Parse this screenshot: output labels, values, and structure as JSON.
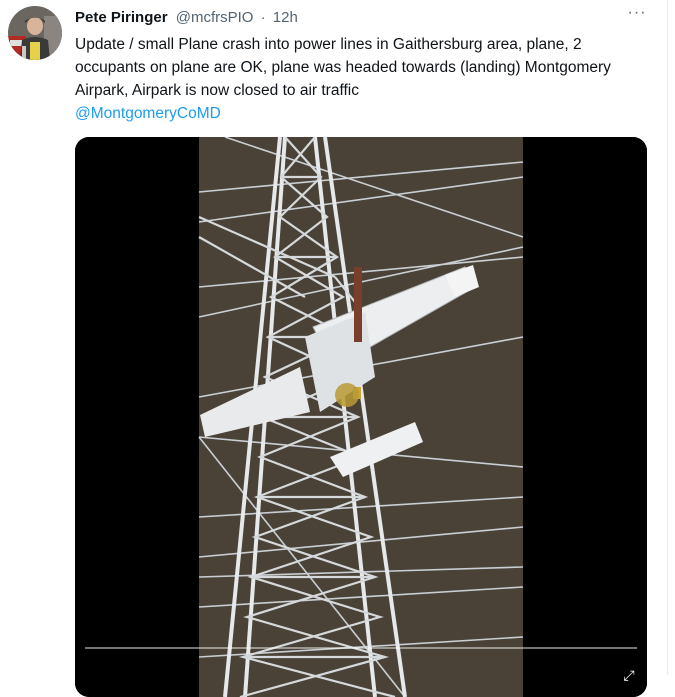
{
  "author": {
    "display_name": "Pete Piringer",
    "handle": "@mcfrsPIO",
    "separator": "·",
    "timestamp": "12h",
    "avatar_icon": "firefighter-avatar"
  },
  "more_menu": {
    "label": "···",
    "icon": "more-horizontal-icon"
  },
  "tweet": {
    "text": "Update / small Plane crash into power lines in Gaithersburg area, plane, 2 occupants on plane are OK, plane was headed towards (landing) Montgomery Airpark, Airpark is now closed to air traffic",
    "mention": "@MontgomeryCoMD"
  },
  "video": {
    "description_icon": "video-thumbnail",
    "progress_fraction": 0,
    "control_icon": "fullscreen-icon"
  },
  "colors": {
    "link": "#1d9bf0",
    "secondary_text": "#536471",
    "primary_text": "#0f1419",
    "sky": "#4a4237"
  }
}
